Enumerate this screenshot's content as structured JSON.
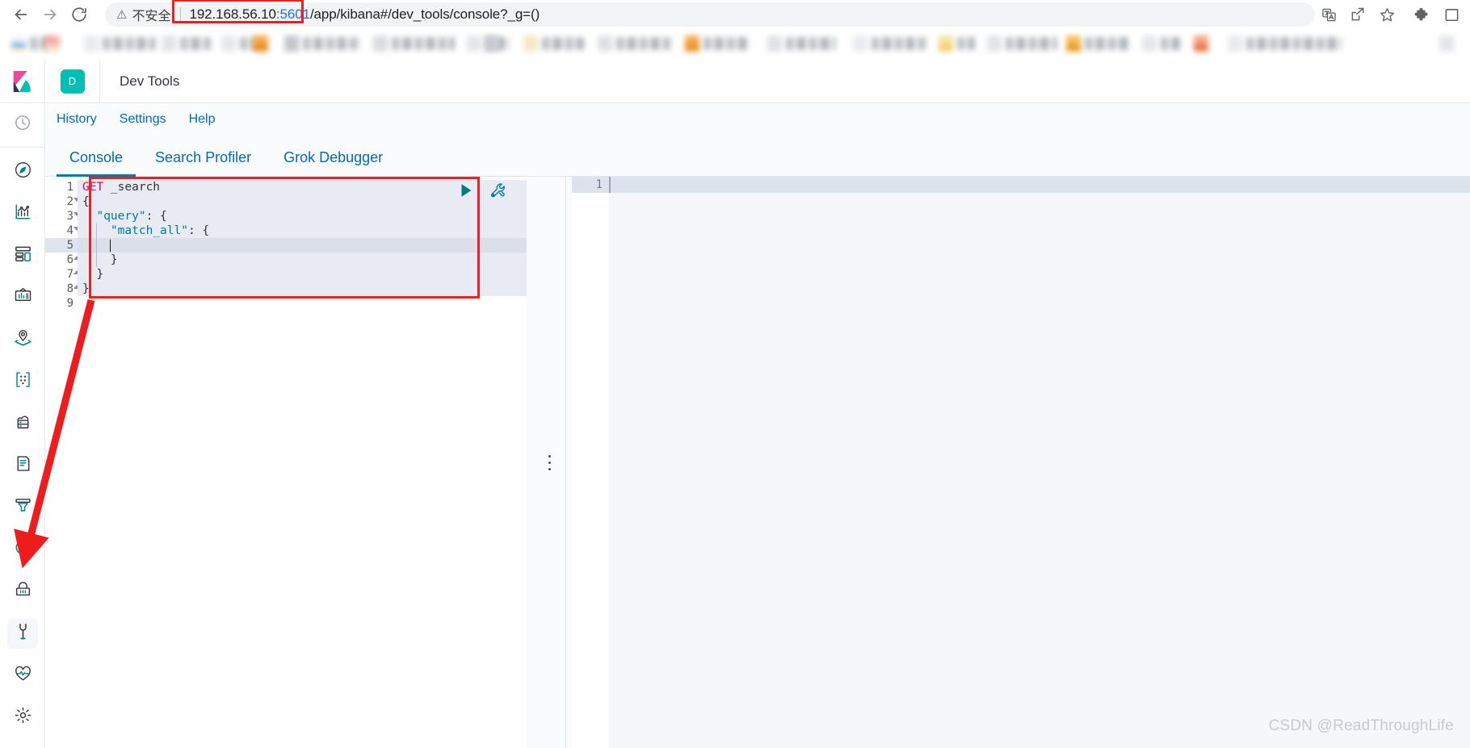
{
  "browser": {
    "back_label": "back-arrow",
    "forward_label": "forward-arrow",
    "reload_label": "reload",
    "security_text": "不安全",
    "url_host": "192.168.56.10",
    "url_port": ":5601",
    "url_path": "/app/kibana#/dev_tools/console?_g=()",
    "url_full": "192.168.56.10:5601/app/kibana#/dev_tools/console?_g=()",
    "toolbar_icons": [
      "translate-icon",
      "share-icon",
      "bookmark-star-icon",
      "extensions-puzzle-icon",
      "browser-panel-icon"
    ],
    "highlight_color": "#ef1f1f"
  },
  "kibana": {
    "logo_name": "kibana-logo",
    "app_badge": "D",
    "app_title": "Dev Tools",
    "accent_color": "#00bfb3",
    "link_color": "#006bb4"
  },
  "nav_rail": {
    "items": [
      {
        "icon": "recently-viewed-clock-icon",
        "label": "Recently viewed",
        "selected": false
      },
      {
        "icon": "compass-discover-icon",
        "label": "Discover",
        "selected": false
      },
      {
        "icon": "visualize-chart-icon",
        "label": "Visualize",
        "selected": false
      },
      {
        "icon": "dashboard-grid-icon",
        "label": "Dashboard",
        "selected": false
      },
      {
        "icon": "canvas-frame-icon",
        "label": "Canvas",
        "selected": false
      },
      {
        "icon": "maps-layers-pin-icon",
        "label": "Maps",
        "selected": false
      },
      {
        "icon": "machine-learning-nodes-icon",
        "label": "Machine Learning",
        "selected": false
      },
      {
        "icon": "infrastructure-server-cloud-icon",
        "label": "Infrastructure",
        "selected": false
      },
      {
        "icon": "logs-document-icon",
        "label": "Logs",
        "selected": false
      },
      {
        "icon": "apm-funnel-icon",
        "label": "APM",
        "selected": false
      },
      {
        "icon": "uptime-clock-check-icon",
        "label": "Uptime",
        "selected": false
      },
      {
        "icon": "siem-lock-icon",
        "label": "SIEM",
        "selected": false
      },
      {
        "icon": "dev-tools-wrench-icon",
        "label": "Dev Tools",
        "selected": true
      },
      {
        "icon": "monitoring-heartbeat-icon",
        "label": "Monitoring",
        "selected": false
      },
      {
        "icon": "management-gear-icon",
        "label": "Management",
        "selected": false
      }
    ]
  },
  "sub_nav": {
    "links": [
      {
        "label": "History",
        "name": "history"
      },
      {
        "label": "Settings",
        "name": "settings"
      },
      {
        "label": "Help",
        "name": "help"
      }
    ]
  },
  "tabs": [
    {
      "label": "Console",
      "active": true
    },
    {
      "label": "Search Profiler",
      "active": false
    },
    {
      "label": "Grok Debugger",
      "active": false
    }
  ],
  "editor": {
    "run_icon": "play-triangle-icon",
    "wrench_icon": "wrench-actions-icon",
    "run_color": "#017d73",
    "wrench_color": "#006bb4",
    "cursor_line": 5,
    "lines": [
      {
        "no": "1",
        "fold": "",
        "segments": [
          {
            "t": "GET",
            "c": "tok-method"
          },
          {
            "t": " _search",
            "c": "tok-url"
          }
        ]
      },
      {
        "no": "2",
        "fold": "open",
        "segments": [
          {
            "t": "{",
            "c": "tok-punct"
          }
        ]
      },
      {
        "no": "3",
        "fold": "open",
        "segments": [
          {
            "t": "  ",
            "c": "tok-punct"
          },
          {
            "t": "\"query\"",
            "c": "tok-key"
          },
          {
            "t": ": {",
            "c": "tok-punct"
          }
        ]
      },
      {
        "no": "4",
        "fold": "open",
        "segments": [
          {
            "t": "    ",
            "c": "tok-punct"
          },
          {
            "t": "\"match_all\"",
            "c": "tok-key"
          },
          {
            "t": ": {",
            "c": "tok-punct"
          }
        ]
      },
      {
        "no": "5",
        "fold": "",
        "segments": [
          {
            "t": "      ",
            "c": "tok-punct"
          }
        ]
      },
      {
        "no": "6",
        "fold": "close",
        "segments": [
          {
            "t": "    }",
            "c": "tok-punct"
          }
        ]
      },
      {
        "no": "7",
        "fold": "close",
        "segments": [
          {
            "t": "  }",
            "c": "tok-punct"
          }
        ]
      },
      {
        "no": "8",
        "fold": "close",
        "segments": [
          {
            "t": "}",
            "c": "tok-punct"
          }
        ]
      },
      {
        "no": "9",
        "fold": "",
        "segments": [
          {
            "t": "",
            "c": "tok-punct"
          }
        ]
      }
    ],
    "raw_text": "GET _search\n{\n  \"query\": {\n    \"match_all\": {\n      \n    }\n  }\n}\n"
  },
  "output": {
    "line_numbers": [
      "1"
    ],
    "content": ""
  },
  "splitter": {
    "name": "pane-splitter-handle"
  },
  "watermark": "CSDN @ReadThroughLife"
}
